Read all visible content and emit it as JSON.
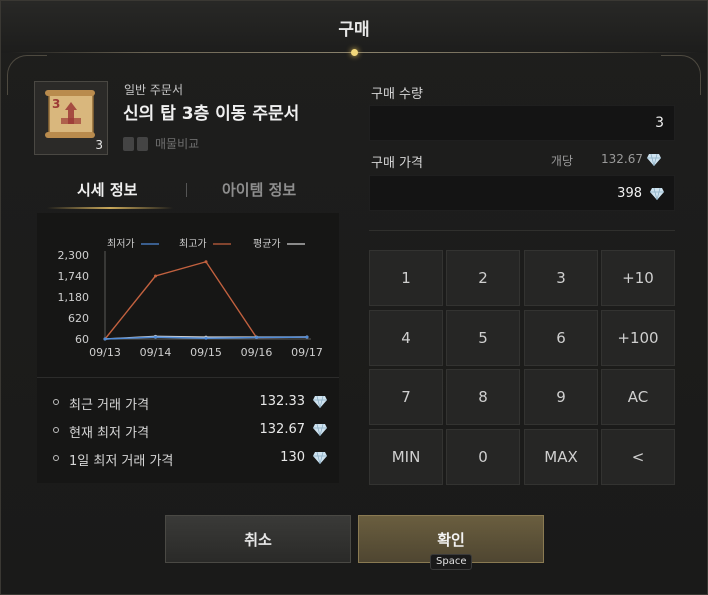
{
  "dialog": {
    "title": "구매"
  },
  "item": {
    "category": "일반 주문서",
    "name": "신의 탑 3층 이동 주문서",
    "count": "3",
    "icon_label": "3",
    "compare_label": "매물비교"
  },
  "tabs": [
    {
      "label": "시세 정보",
      "active": true
    },
    {
      "label": "아이템 정보",
      "active": false
    }
  ],
  "chart_data": {
    "type": "line",
    "x": [
      "09/13",
      "09/14",
      "09/15",
      "09/16",
      "09/17"
    ],
    "series": [
      {
        "name": "최저가",
        "color": "#4f8ad6",
        "values": [
          60,
          110,
          80,
          100,
          110
        ]
      },
      {
        "name": "최고가",
        "color": "#c2613f",
        "values": [
          60,
          1740,
          2120,
          100,
          110
        ]
      },
      {
        "name": "평균가",
        "color": "#d0d0d0",
        "values": [
          60,
          130,
          110,
          110,
          115
        ]
      }
    ],
    "yticks": [
      "2,300",
      "1,740",
      "1,180",
      "620",
      "60"
    ],
    "ytick_values": [
      2300,
      1740,
      1180,
      620,
      60
    ],
    "ylim": [
      60,
      2300
    ],
    "legend_position": "top"
  },
  "stats": [
    {
      "label": "최근 거래 가격",
      "value": "132.33"
    },
    {
      "label": "현재 최저 가격",
      "value": "132.67"
    },
    {
      "label": "1일 최저 거래 가격",
      "value": "130"
    }
  ],
  "purchase": {
    "quantity_label": "구매 수량",
    "quantity_value": "3",
    "price_label": "구매 가격",
    "unit_price_label": "개당",
    "unit_price_value": "132.67",
    "total_price": "398"
  },
  "keypad": [
    "1",
    "2",
    "3",
    "+10",
    "4",
    "5",
    "6",
    "+100",
    "7",
    "8",
    "9",
    "AC",
    "MIN",
    "0",
    "MAX",
    "<"
  ],
  "buttons": {
    "cancel": "취소",
    "confirm": "확인",
    "confirm_shortcut": "Space"
  },
  "colors": {
    "accent_gold": "#c9a85a",
    "gem": "#cfe3f0"
  }
}
